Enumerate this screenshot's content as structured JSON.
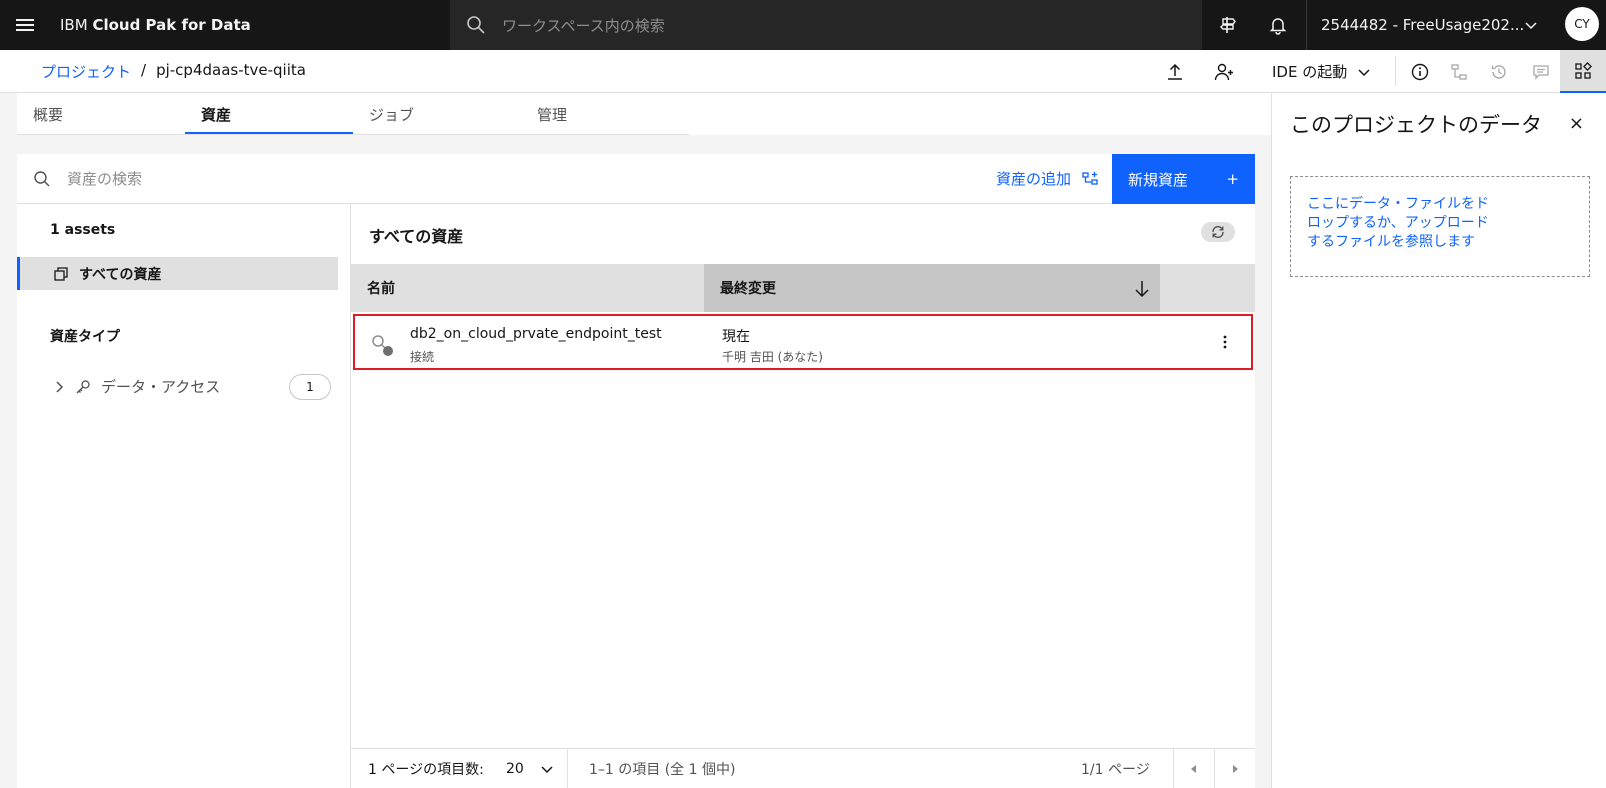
{
  "topbar": {
    "brand_prefix": "IBM ",
    "brand_bold": "Cloud Pak for Data",
    "search_placeholder": "ワークスペース内の検索",
    "account": "2544482 - FreeUsage202...",
    "avatar_initials": "CY"
  },
  "breadcrumb": {
    "root": "プロジェクト",
    "separator": "/",
    "current": "pj-cp4daas-tve-qiita"
  },
  "toolbar": {
    "ide_label": "IDE の起動"
  },
  "tabs": [
    {
      "label": "概要"
    },
    {
      "label": "資産"
    },
    {
      "label": "ジョブ"
    },
    {
      "label": "管理"
    }
  ],
  "assetbar": {
    "search_placeholder": "資産の検索",
    "add_label": "資産の追加",
    "new_label": "新規資産",
    "new_plus": "+"
  },
  "leftpanel": {
    "count": "1 assets",
    "all_assets": "すべての資産",
    "type_heading": "資産タイプ",
    "data_access": "データ・アクセス",
    "data_access_count": "1"
  },
  "main": {
    "title": "すべての資産",
    "columns": {
      "name": "名前",
      "modified": "最終変更"
    },
    "rows": [
      {
        "name": "db2_on_cloud_prvate_endpoint_test",
        "type": "接続",
        "modified": "現在",
        "user": "千明 吉田 (あなた)"
      }
    ]
  },
  "pager": {
    "per_page_label": "1 ページの項目数:",
    "per_page_value": "20",
    "range": "1–1 の項目 (全 1 個中)",
    "page_info": "1/1 ページ"
  },
  "rightpanel": {
    "title": "このプロジェクトのデータ",
    "close": "×",
    "dropzone": "ここにデータ・ファイルをドロップするか、アップロードするファイルを参照します"
  },
  "colors": {
    "primary": "#0f62fe",
    "highlight": "#da1e28",
    "topbar": "#161616"
  }
}
